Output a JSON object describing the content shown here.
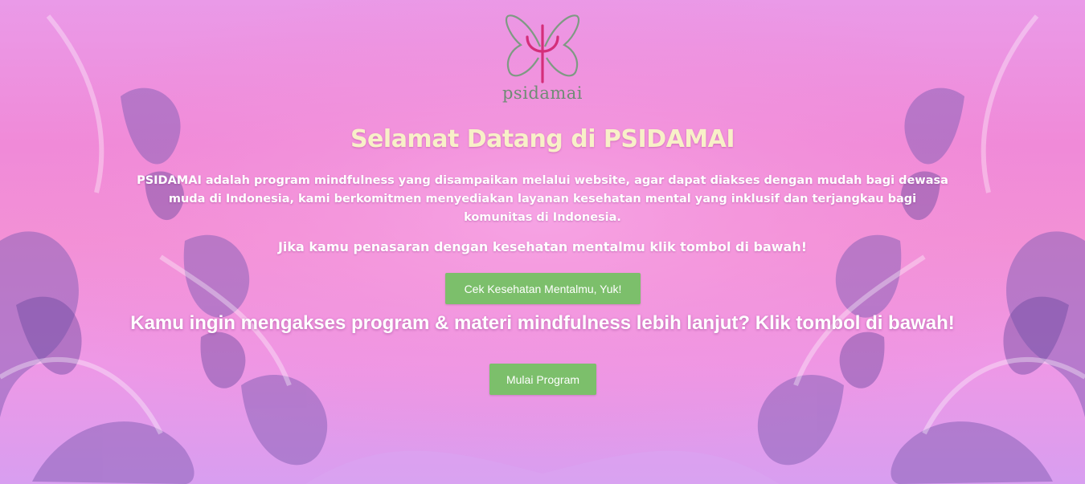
{
  "brand": {
    "logo_text": "psidamai",
    "logo_colors": {
      "leaf": "#7e9a83",
      "psi": "#d42e7a"
    }
  },
  "hero": {
    "title": "Selamat Datang di PSIDAMAI",
    "description": "PSIDAMAI adalah program mindfulness yang disampaikan melalui website, agar dapat diakses dengan mudah bagi dewasa muda di Indonesia, kami berkomitmen menyediakan layanan kesehatan mental yang inklusif dan terjangkau bagi komunitas di Indonesia.",
    "prompt_check": "Jika kamu penasaran dengan kesehatan mentalmu klik tombol di bawah!",
    "check_button": "Cek Kesehatan Mentalmu, Yuk!",
    "prompt_program": "Kamu ingin mengakses program & materi mindfulness lebih lanjut? Klik tombol di bawah!",
    "program_button": "Mulai Program"
  },
  "colors": {
    "title": "#f8f0c8",
    "button": "#7cbf6b",
    "background": "#f08ad8"
  }
}
